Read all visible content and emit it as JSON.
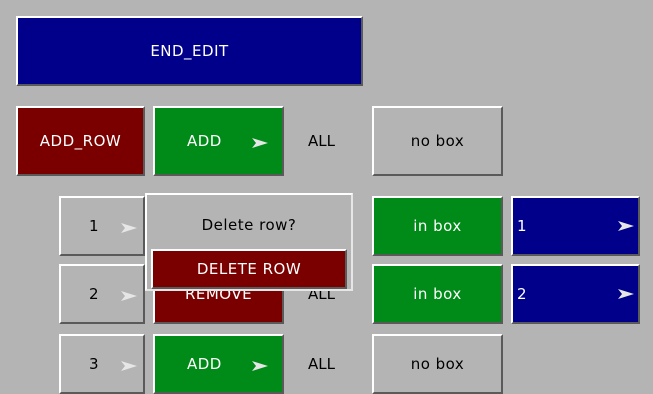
{
  "top": {
    "end_edit": "END_EDIT"
  },
  "header_row": {
    "add_row": "ADD_ROW",
    "mode": "ADD",
    "scope": "ALL",
    "box": "no box"
  },
  "rows": [
    {
      "index": "1",
      "box": "in box",
      "value": "1"
    },
    {
      "index": "2",
      "mode": "REMOVE",
      "scope": "ALL",
      "box": "in box",
      "value": "2"
    },
    {
      "index": "3",
      "mode": "ADD",
      "scope": "ALL",
      "box": "no box"
    }
  ],
  "popup": {
    "question": "Delete row?",
    "confirm": "DELETE ROW"
  },
  "colors": {
    "background": "#b4b4b4",
    "navy": "#00008a",
    "dark_red": "#7a0000",
    "green": "#008a18"
  }
}
